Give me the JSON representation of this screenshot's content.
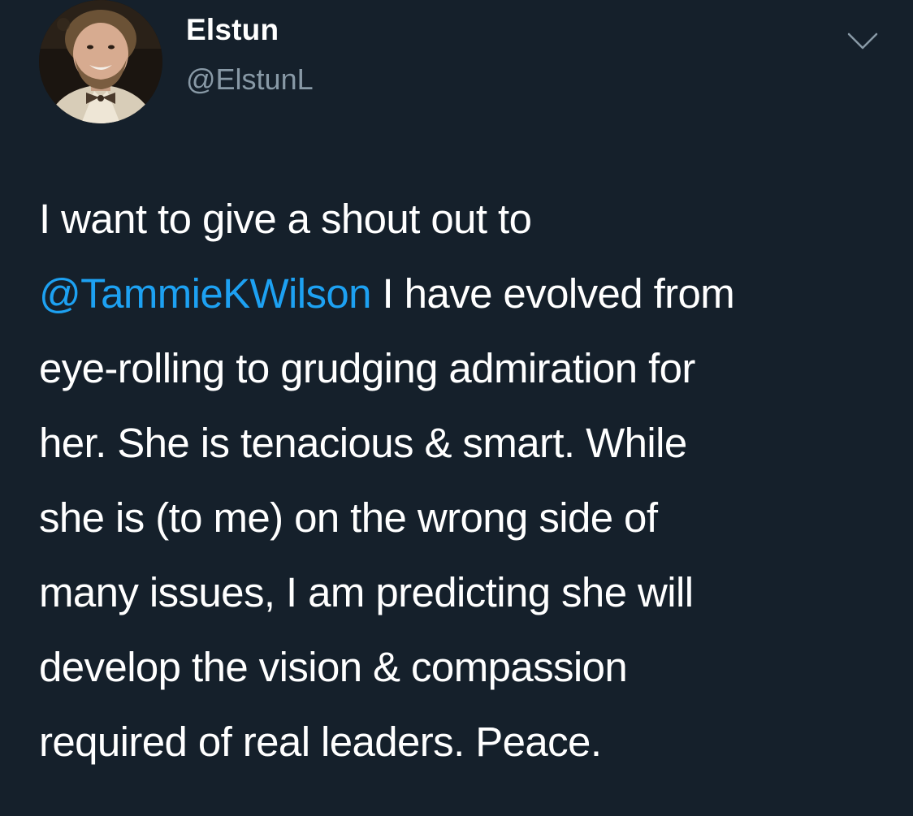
{
  "tweet": {
    "author": {
      "display_name": "Elstun",
      "handle": "@ElstunL",
      "avatar_icon": "profile-photo"
    },
    "menu_icon": "chevron-down-icon",
    "body": {
      "line1": "I want to give a shout out to",
      "mention": "@TammieKWilson",
      "line2_rest": " I have evolved from",
      "line3": "eye-rolling to grudging admiration for",
      "line4": "her. She is tenacious & smart. While",
      "line5": "she is (to me) on the wrong side of",
      "line6": "many issues, I am predicting she will",
      "line7": "develop the vision & compassion",
      "line8": "required of real leaders. Peace."
    }
  },
  "colors": {
    "background": "#15202b",
    "text": "#ffffff",
    "secondary_text": "#8899a6",
    "link": "#1da1f2"
  }
}
